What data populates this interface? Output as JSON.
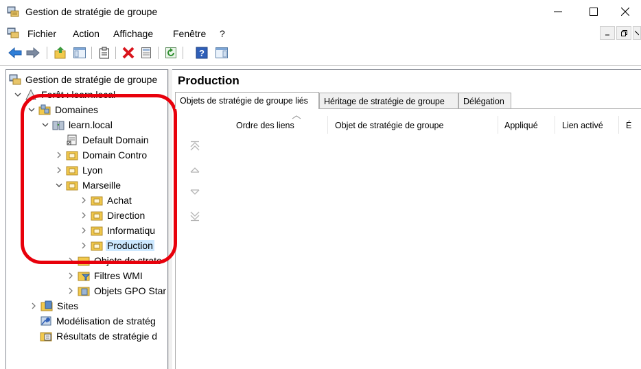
{
  "window": {
    "title": "Gestion de stratégie de groupe",
    "controls": {
      "minimize": "minimize",
      "maximize": "maximize",
      "close": "close"
    }
  },
  "menu": {
    "items": [
      "Fichier",
      "Action",
      "Affichage",
      "Fenêtre",
      "?"
    ]
  },
  "toolbar": {
    "buttons": [
      "back-arrow-icon",
      "forward-arrow-icon",
      "up-folder-icon",
      "show-hide-tree-icon",
      "clipboard-icon",
      "delete-icon",
      "properties-icon",
      "refresh-icon",
      "help-icon",
      "action-pane-icon"
    ]
  },
  "tree": {
    "root": "Gestion de stratégie de groupe",
    "forest": "Forêt : learn.local",
    "domains": "Domaines",
    "domain": "learn.local",
    "default_domain": "Default Domain",
    "domain_controllers": "Domain Contro",
    "lyon": "Lyon",
    "marseille": "Marseille",
    "achat": "Achat",
    "direction": "Direction",
    "informatique": "Informatiqu",
    "production": "Production",
    "gpo_objects": "Objets de strate",
    "wmi_filters": "Filtres WMI",
    "starter_gpo": "Objets GPO Star",
    "sites": "Sites",
    "modeling": "Modélisation de stratég",
    "results": "Résultats de stratégie d"
  },
  "right_pane": {
    "heading": "Production",
    "tabs": [
      "Objets de stratégie de groupe liés",
      "Héritage de stratégie de groupe",
      "Délégation"
    ],
    "active_tab": 0,
    "columns": [
      "Ordre des liens",
      "Objet de stratégie de groupe",
      "Appliqué",
      "Lien activé",
      "É"
    ]
  },
  "colors": {
    "annotation": "#e8000b",
    "selection": "#cce8ff"
  }
}
